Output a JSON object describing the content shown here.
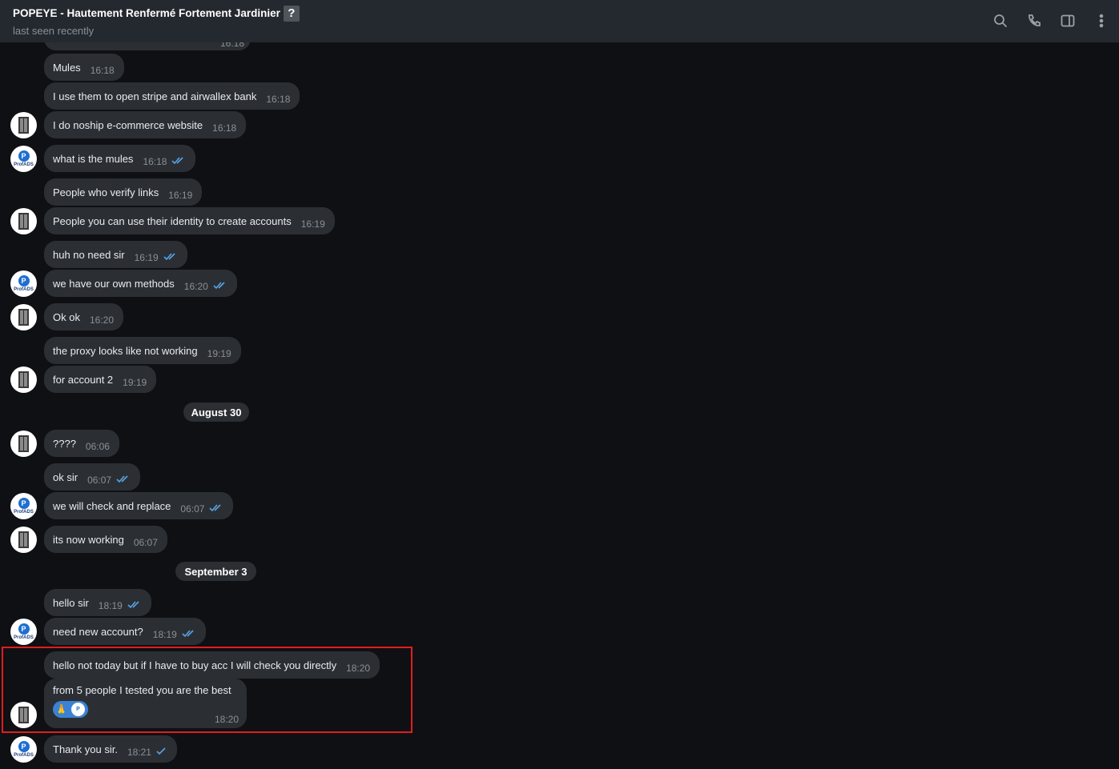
{
  "header": {
    "title": "POPEYE - Hautement Renfermé Fortement Jardinier",
    "badge": "?",
    "status": "last seen recently"
  },
  "icons": {
    "search": "search-icon",
    "call": "phone-icon",
    "panel": "sidebar-toggle-icon",
    "more": "more-vertical-icon"
  },
  "colors": {
    "background": "#0e1014",
    "header": "#24292f",
    "bubble": "#2b2f34",
    "check": "#57a4e6",
    "highlight": "#e41c1c"
  },
  "partial_top_time": "16:18",
  "messages": [
    {
      "text": "Mules",
      "time": "16:18"
    },
    {
      "text": "I use them to open stripe and airwallex bank",
      "time": "16:18"
    },
    {
      "text": "I do noship e-commerce website",
      "time": "16:18"
    },
    {
      "text": "what is the mules",
      "time": "16:18"
    },
    {
      "text": "People who verify links",
      "time": "16:19"
    },
    {
      "text": "People you can use their identity to create accounts",
      "time": "16:19"
    },
    {
      "text": "huh no need sir",
      "time": "16:19"
    },
    {
      "text": "we have our own methods",
      "time": "16:20"
    },
    {
      "text": "Ok ok",
      "time": "16:20"
    },
    {
      "text": "the proxy looks like not working",
      "time": "19:19"
    },
    {
      "text": "for account 2",
      "time": "19:19"
    },
    {
      "text": "????",
      "time": "06:06"
    },
    {
      "text": "ok sir",
      "time": "06:07"
    },
    {
      "text": "we will check and replace",
      "time": "06:07"
    },
    {
      "text": "its now working",
      "time": "06:07"
    },
    {
      "text": "hello sir",
      "time": "18:19"
    },
    {
      "text": "need new account?",
      "time": "18:19"
    },
    {
      "text": "hello not today but if I have to buy acc I will check you directly",
      "time": "18:20"
    },
    {
      "text": "from 5 people I tested you are the best",
      "time": "18:20"
    },
    {
      "text": "Thank you sir.",
      "time": "18:21"
    }
  ],
  "dates": [
    "August 30",
    "September 3"
  ],
  "avatar_logo_text": "ProfADS",
  "avatar_logo_letter": "P",
  "reactions": {
    "first": "🙏",
    "second_logo": "P"
  }
}
